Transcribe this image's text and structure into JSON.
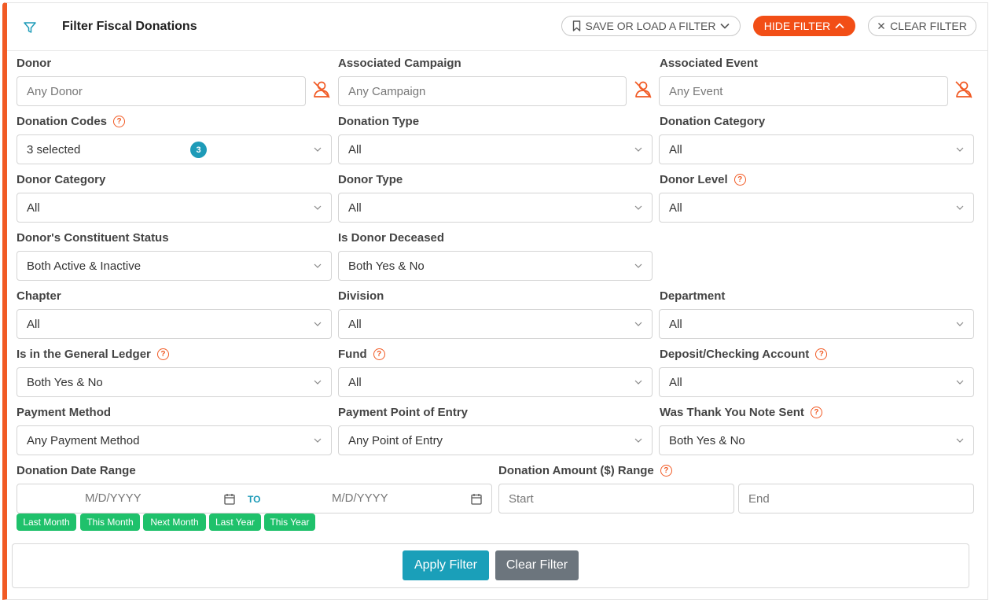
{
  "header": {
    "title": "Filter Fiscal Donations",
    "save_load": "SAVE OR LOAD A FILTER",
    "hide": "HIDE FILTER",
    "clear": "CLEAR FILTER"
  },
  "fields": {
    "donor": {
      "label": "Donor",
      "placeholder": "Any Donor"
    },
    "campaign": {
      "label": "Associated Campaign",
      "placeholder": "Any Campaign"
    },
    "event": {
      "label": "Associated Event",
      "placeholder": "Any Event"
    },
    "donation_codes": {
      "label": "Donation Codes",
      "value": "3 selected",
      "badge": "3"
    },
    "donation_type": {
      "label": "Donation Type",
      "value": "All"
    },
    "donation_category": {
      "label": "Donation Category",
      "value": "All"
    },
    "donor_category": {
      "label": "Donor Category",
      "value": "All"
    },
    "donor_type": {
      "label": "Donor Type",
      "value": "All"
    },
    "donor_level": {
      "label": "Donor Level",
      "value": "All"
    },
    "constituent_status": {
      "label": "Donor's Constituent Status",
      "value": "Both Active & Inactive"
    },
    "donor_deceased": {
      "label": "Is Donor Deceased",
      "value": "Both Yes & No"
    },
    "chapter": {
      "label": "Chapter",
      "value": "All"
    },
    "division": {
      "label": "Division",
      "value": "All"
    },
    "department": {
      "label": "Department",
      "value": "All"
    },
    "general_ledger": {
      "label": "Is in the General Ledger",
      "value": "Both Yes & No"
    },
    "fund": {
      "label": "Fund",
      "value": "All"
    },
    "deposit_account": {
      "label": "Deposit/Checking Account",
      "value": "All"
    },
    "payment_method": {
      "label": "Payment Method",
      "value": "Any Payment Method"
    },
    "point_of_entry": {
      "label": "Payment Point of Entry",
      "value": "Any Point of Entry"
    },
    "thank_you": {
      "label": "Was Thank You Note Sent",
      "value": "Both Yes & No"
    }
  },
  "date_range": {
    "label": "Donation Date Range",
    "start_placeholder": "M/D/YYYY",
    "to": "TO",
    "end_placeholder": "M/D/YYYY",
    "quick": [
      "Last Month",
      "This Month",
      "Next Month",
      "Last Year",
      "This Year"
    ]
  },
  "amount_range": {
    "label": "Donation Amount ($) Range",
    "start_placeholder": "Start",
    "end_placeholder": "End"
  },
  "actions": {
    "apply": "Apply Filter",
    "clear": "Clear Filter"
  },
  "colors": {
    "accent": "#f15a24",
    "teal": "#1e9bb8",
    "green": "#1fc16b",
    "gray": "#6c757d"
  }
}
